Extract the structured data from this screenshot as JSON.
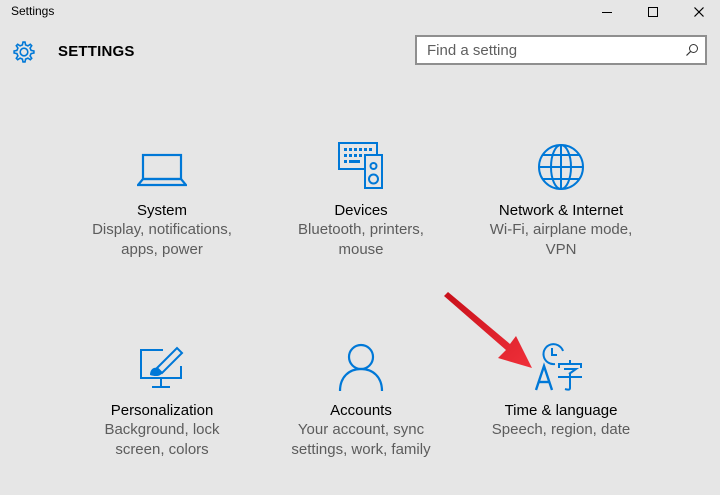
{
  "window": {
    "title": "Settings",
    "controls": [
      "minimize",
      "maximize",
      "close"
    ]
  },
  "header": {
    "title": "SETTINGS",
    "icon": "gear-icon",
    "search_placeholder": "Find a setting"
  },
  "accent_color": "#0078d7",
  "annotation_arrow_color": "#e8131b",
  "tiles": [
    {
      "title": "System",
      "desc1": "Display, notifications,",
      "desc2": "apps, power",
      "icon": "laptop-icon"
    },
    {
      "title": "Devices",
      "desc1": "Bluetooth, printers,",
      "desc2": "mouse",
      "icon": "keyboard-speaker-icon"
    },
    {
      "title": "Network & Internet",
      "desc1": "Wi-Fi, airplane mode,",
      "desc2": "VPN",
      "icon": "globe-icon"
    },
    {
      "title": "Personalization",
      "desc1": "Background, lock",
      "desc2": "screen, colors",
      "icon": "monitor-brush-icon"
    },
    {
      "title": "Accounts",
      "desc1": "Your account, sync",
      "desc2": "settings, work, family",
      "icon": "person-icon"
    },
    {
      "title": "Time & language",
      "desc1": "Speech, region, date",
      "desc2": "",
      "icon": "clock-language-icon"
    }
  ]
}
